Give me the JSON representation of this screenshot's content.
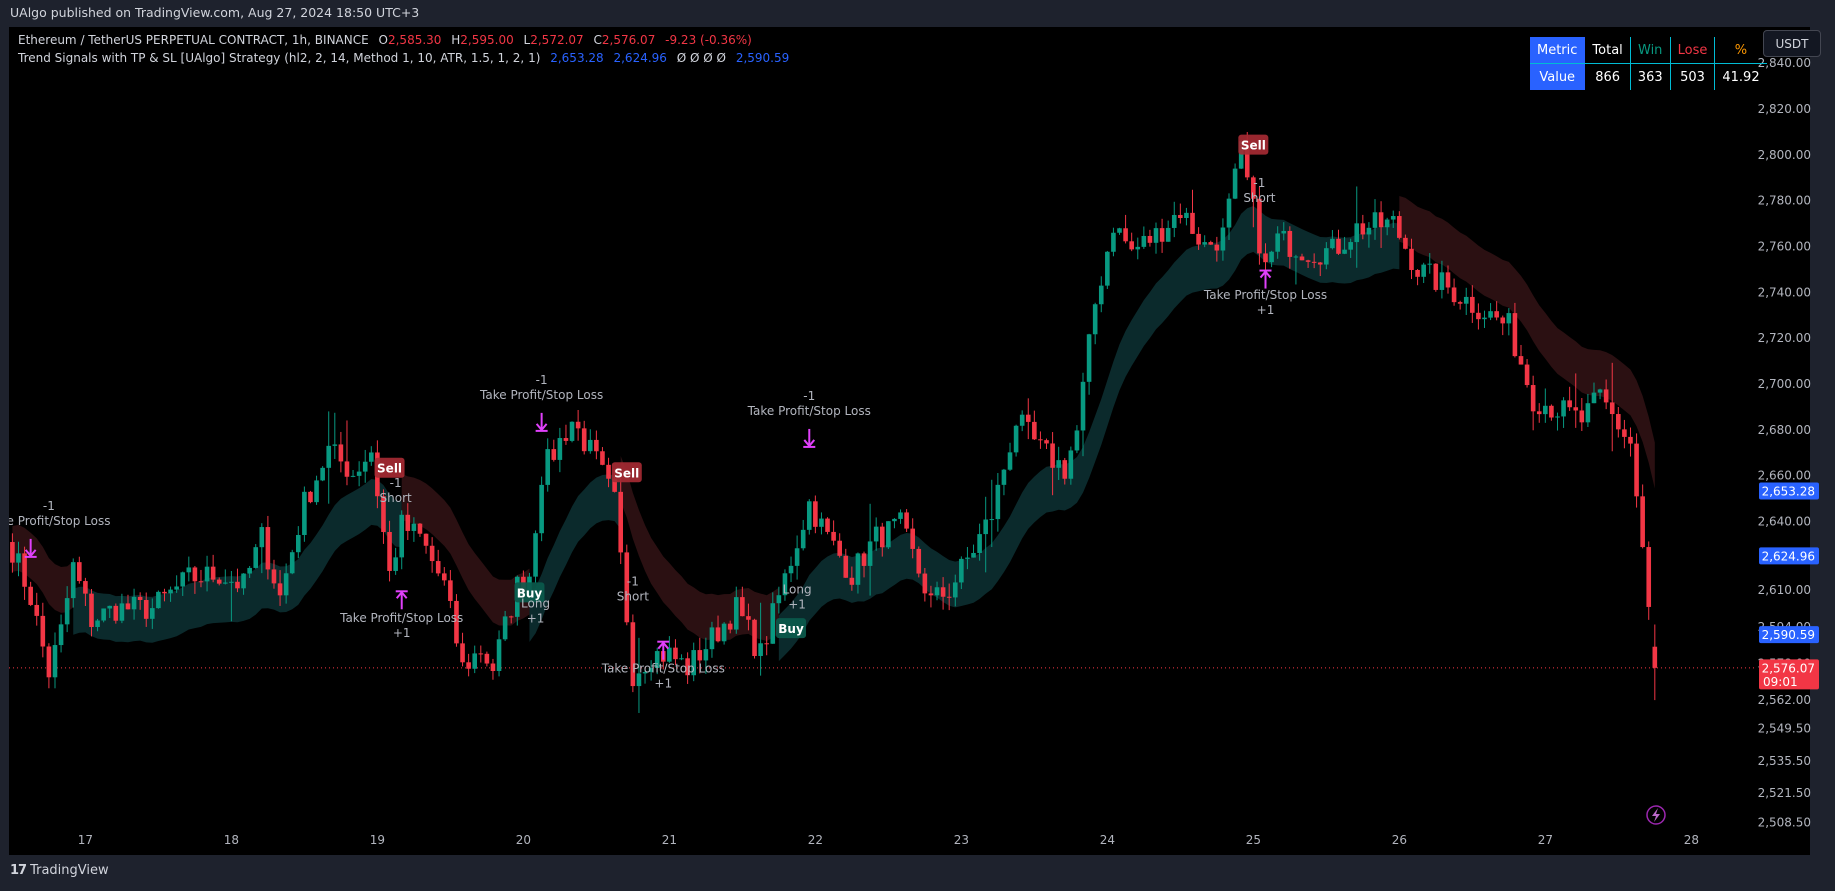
{
  "header": {
    "published": "UAlgo published on TradingView.com, Aug 27, 2024 18:50 UTC+3"
  },
  "legend": {
    "symbol": "Ethereum / TetherUS PERPETUAL CONTRACT, 1h, BINANCE",
    "o_label": "O",
    "o": "2,585.30",
    "h_label": "H",
    "h": "2,595.00",
    "l_label": "L",
    "l": "2,572.07",
    "c_label": "C",
    "c": "2,576.07",
    "change": "-9.23 (-0.36%)",
    "strategy": "Trend Signals with TP & SL [UAlgo] Strategy (hl2, 2, 14, Method 1, 10, ATR, 1.5, 1, 2, 1)",
    "v1": "2,653.28",
    "v2": "2,624.96",
    "na": "Ø Ø Ø Ø",
    "v3": "2,590.59"
  },
  "stats_table": {
    "headers": [
      "Metric",
      "Total",
      "Win",
      "Lose",
      "%"
    ],
    "row": [
      "Value",
      "866",
      "363",
      "503",
      "41.92"
    ],
    "colors": {
      "metric_bg": "#2962ff",
      "win": "#089981",
      "lose": "#f23645",
      "pct": "#ff9800",
      "border": "#00bcd4"
    }
  },
  "currency_button": "USDT",
  "footer": {
    "brand": "TradingView"
  },
  "colors": {
    "up": "#089981",
    "down": "#f23645",
    "band_up": "#0b2a2c",
    "band_down": "#2b1012",
    "signal_tp": "#e040fb",
    "badge_blue": "#2962ff",
    "badge_red": "#f23645"
  },
  "chart_data": {
    "type": "candlestick",
    "symbol": "ETHUSDT.P",
    "timeframe": "1h",
    "price_scale": {
      "ylim": [
        2500,
        2850
      ],
      "ticks": [
        "2,840.00",
        "2,820.00",
        "2,800.00",
        "2,780.00",
        "2,760.00",
        "2,740.00",
        "2,720.00",
        "2,700.00",
        "2,680.00",
        "2,660.00",
        "2,640.00",
        "2,610.00",
        "2,594.00",
        "2,578.00",
        "2,562.00",
        "2,549.50",
        "2,535.50",
        "2,521.50",
        "2,508.50"
      ]
    },
    "time_ticks": [
      "17",
      "18",
      "19",
      "20",
      "21",
      "22",
      "23",
      "24",
      "25",
      "26",
      "27",
      "28"
    ],
    "approx_close_path": [
      [
        "2024-08-16T12:00",
        2628
      ],
      [
        "2024-08-16T15:00",
        2607
      ],
      [
        "2024-08-16T18:00",
        2574
      ],
      [
        "2024-08-16T20:00",
        2592
      ],
      [
        "2024-08-16T22:00",
        2620
      ],
      [
        "2024-08-17T01:00",
        2597
      ],
      [
        "2024-08-17T05:00",
        2602
      ],
      [
        "2024-08-17T11:00",
        2602
      ],
      [
        "2024-08-17T17:00",
        2615
      ],
      [
        "2024-08-17T22:00",
        2617
      ],
      [
        "2024-08-18T02:00",
        2612
      ],
      [
        "2024-08-18T05:00",
        2633
      ],
      [
        "2024-08-18T08:00",
        2607
      ],
      [
        "2024-08-18T12:00",
        2648
      ],
      [
        "2024-08-18T16:00",
        2671
      ],
      [
        "2024-08-18T20:00",
        2661
      ],
      [
        "2024-08-18T23:00",
        2671
      ],
      [
        "2024-08-19T02:00",
        2617
      ],
      [
        "2024-08-19T04:00",
        2638
      ],
      [
        "2024-08-19T07:00",
        2633
      ],
      [
        "2024-08-19T11:00",
        2612
      ],
      [
        "2024-08-19T14:00",
        2576
      ],
      [
        "2024-08-19T17:00",
        2584
      ],
      [
        "2024-08-19T19:00",
        2576
      ],
      [
        "2024-08-19T23:00",
        2612
      ],
      [
        "2024-08-20T01:00",
        2617
      ],
      [
        "2024-08-20T03:00",
        2661
      ],
      [
        "2024-08-20T08:00",
        2684
      ],
      [
        "2024-08-20T12:00",
        2666
      ],
      [
        "2024-08-20T15:00",
        2648
      ],
      [
        "2024-08-20T18:00",
        2574
      ],
      [
        "2024-08-20T21:00",
        2582
      ],
      [
        "2024-08-21T00:00",
        2582
      ],
      [
        "2024-08-21T03:00",
        2576
      ],
      [
        "2024-08-21T07:00",
        2589
      ],
      [
        "2024-08-21T11:00",
        2602
      ],
      [
        "2024-08-21T15:00",
        2582
      ],
      [
        "2024-08-21T18:00",
        2607
      ],
      [
        "2024-08-21T23:00",
        2648
      ],
      [
        "2024-08-22T02:00",
        2633
      ],
      [
        "2024-08-22T06:00",
        2617
      ],
      [
        "2024-08-22T10:00",
        2633
      ],
      [
        "2024-08-22T14:00",
        2638
      ],
      [
        "2024-08-22T19:00",
        2605
      ],
      [
        "2024-08-22T22:00",
        2610
      ],
      [
        "2024-08-23T02:00",
        2628
      ],
      [
        "2024-08-23T05:00",
        2643
      ],
      [
        "2024-08-23T09:00",
        2684
      ],
      [
        "2024-08-23T13:00",
        2671
      ],
      [
        "2024-08-23T17:00",
        2663
      ],
      [
        "2024-08-23T19:00",
        2679
      ],
      [
        "2024-08-23T22:00",
        2735
      ],
      [
        "2024-08-24T01:00",
        2770
      ],
      [
        "2024-08-24T04:00",
        2758
      ],
      [
        "2024-08-24T08:00",
        2765
      ],
      [
        "2024-08-24T12:00",
        2776
      ],
      [
        "2024-08-24T16:00",
        2760
      ],
      [
        "2024-08-24T19:00",
        2765
      ],
      [
        "2024-08-24T22:00",
        2801
      ],
      [
        "2024-08-24T23:00",
        2788
      ],
      [
        "2024-08-25T02:00",
        2750
      ],
      [
        "2024-08-25T04:00",
        2763
      ],
      [
        "2024-08-25T09:00",
        2758
      ],
      [
        "2024-08-25T13:00",
        2758
      ],
      [
        "2024-08-25T17:00",
        2768
      ],
      [
        "2024-08-25T23:00",
        2770
      ],
      [
        "2024-08-26T03:00",
        2750
      ],
      [
        "2024-08-26T08:00",
        2742
      ],
      [
        "2024-08-26T12:00",
        2735
      ],
      [
        "2024-08-26T18:00",
        2725
      ],
      [
        "2024-08-26T22:00",
        2694
      ],
      [
        "2024-08-27T02:00",
        2689
      ],
      [
        "2024-08-27T06:00",
        2684
      ],
      [
        "2024-08-27T09:00",
        2694
      ],
      [
        "2024-08-27T14:00",
        2674
      ],
      [
        "2024-08-27T16:00",
        2628
      ],
      [
        "2024-08-27T17:00",
        2600
      ],
      [
        "2024-08-27T18:00",
        2576.07
      ]
    ],
    "trend_segments": [
      {
        "from": "2024-08-16T12:00",
        "to": "2024-08-16T22:00",
        "trend": "down"
      },
      {
        "from": "2024-08-16T22:00",
        "to": "2024-08-19T04:00",
        "trend": "up"
      },
      {
        "from": "2024-08-19T04:00",
        "to": "2024-08-20T01:00",
        "trend": "down"
      },
      {
        "from": "2024-08-20T01:00",
        "to": "2024-08-20T16:00",
        "trend": "up"
      },
      {
        "from": "2024-08-20T16:00",
        "to": "2024-08-21T18:00",
        "trend": "down"
      },
      {
        "from": "2024-08-21T18:00",
        "to": "2024-08-26T00:00",
        "trend": "up"
      },
      {
        "from": "2024-08-26T00:00",
        "to": "2024-08-27T18:00",
        "trend": "down"
      }
    ],
    "signals": [
      {
        "label": "Sell",
        "time": "2024-08-19T02:00",
        "price": 2663
      },
      {
        "label": "Buy",
        "time": "2024-08-20T01:00",
        "price": 2608.6
      },
      {
        "label": "Sell",
        "time": "2024-08-20T17:00",
        "price": 2661
      },
      {
        "label": "Buy",
        "time": "2024-08-21T20:00",
        "price": 2593
      },
      {
        "label": "Sell",
        "time": "2024-08-25T00:00",
        "price": 2804
      }
    ],
    "annotations": [
      {
        "time": "2024-08-16T18:00",
        "price": 2645,
        "lines": [
          "-1",
          "Take Profit/Stop Loss"
        ]
      },
      {
        "time": "2024-08-19T03:00",
        "price": 2655,
        "lines": [
          "-1",
          "Short"
        ]
      },
      {
        "time": "2024-08-19T04:00",
        "price": 2596,
        "lines": [
          "Take Profit/Stop Loss",
          "+1"
        ]
      },
      {
        "time": "2024-08-20T02:00",
        "price": 2602.5,
        "lines": [
          "Long",
          "+1"
        ]
      },
      {
        "time": "2024-08-20T03:00",
        "price": 2700,
        "lines": [
          "-1",
          "Take Profit/Stop Loss"
        ]
      },
      {
        "time": "2024-08-20T18:00",
        "price": 2612,
        "lines": [
          "-1",
          "Short"
        ]
      },
      {
        "time": "2024-08-20T23:00",
        "price": 2574,
        "lines": [
          "Take Profit/Stop Loss",
          "+1"
        ]
      },
      {
        "time": "2024-08-21T21:00",
        "price": 2608.6,
        "lines": [
          "Long",
          "+1"
        ]
      },
      {
        "time": "2024-08-21T23:00",
        "price": 2693,
        "lines": [
          "-1",
          "Take Profit/Stop Loss"
        ]
      },
      {
        "time": "2024-08-25T01:00",
        "price": 2786,
        "lines": [
          "-1",
          "Short"
        ]
      },
      {
        "time": "2024-08-25T02:00",
        "price": 2737,
        "lines": [
          "Take Profit/Stop Loss",
          "+1"
        ]
      }
    ],
    "tp_arrows": [
      {
        "time": "2024-08-16T15:00",
        "price": 2628,
        "dir": "down"
      },
      {
        "time": "2024-08-19T04:00",
        "price": 2606,
        "dir": "up"
      },
      {
        "time": "2024-08-20T03:00",
        "price": 2683,
        "dir": "down"
      },
      {
        "time": "2024-08-20T23:00",
        "price": 2584,
        "dir": "up"
      },
      {
        "time": "2024-08-21T23:00",
        "price": 2676,
        "dir": "down"
      },
      {
        "time": "2024-08-25T02:00",
        "price": 2746,
        "dir": "up"
      }
    ],
    "price_badges": [
      {
        "value": 2653.28,
        "text": "2,653.28",
        "color": "blue"
      },
      {
        "value": 2624.96,
        "text": "2,624.96",
        "color": "blue"
      },
      {
        "value": 2590.59,
        "text": "2,590.59",
        "color": "blue"
      },
      {
        "value": 2576.07,
        "text": "2,576.07",
        "sub": "09:01",
        "color": "red"
      }
    ],
    "current_price": 2576.07
  }
}
